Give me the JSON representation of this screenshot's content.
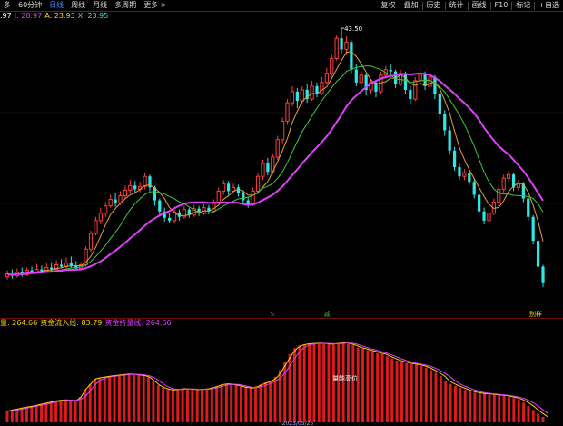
{
  "toolbar": {
    "left": [
      {
        "label": "多",
        "active": false
      },
      {
        "label": "60分钟",
        "active": false
      },
      {
        "label": "日线",
        "active": true
      },
      {
        "label": "周线",
        "active": false
      },
      {
        "label": "月线",
        "active": false
      },
      {
        "label": "多周期",
        "active": false
      },
      {
        "label": "更多 >",
        "active": false
      }
    ],
    "right": [
      "复权",
      "叠加",
      "历史",
      "统计",
      "画线",
      "F10",
      "标记",
      "+自选"
    ]
  },
  "legend": {
    "parts": [
      {
        "text": ".97",
        "color": "#ffffff"
      },
      {
        "text": "J: 28.97",
        "color": "#e040fb"
      },
      {
        "text": "A: 23.93",
        "color": "#ffd400"
      },
      {
        "text": "X: 23.95",
        "color": "#33e0e0"
      }
    ]
  },
  "indicator_legend": {
    "parts": [
      {
        "text": "量: 264.66",
        "color": "#ffd400"
      },
      {
        "text": "资金流入线: 83.79",
        "color": "#ffd400"
      },
      {
        "text": "资金持量线: 264.66",
        "color": "#e040fb"
      }
    ]
  },
  "annotations": {
    "high_price": "43.50",
    "markers": [
      {
        "text": "S",
        "color": "#ff3b3b"
      },
      {
        "text": "减",
        "color": "#33cc33"
      },
      {
        "text": "别样",
        "color": "#ffd400"
      }
    ],
    "indicator_center": "量能高位",
    "bottom_date": "2023/05/25"
  },
  "chart_data": [
    {
      "type": "candlestick",
      "title": "",
      "price_range": [
        14,
        44
      ],
      "label_max": "43.50",
      "candles": [
        [
          16.5,
          16.8,
          17.2,
          16.2
        ],
        [
          16.8,
          16.6,
          17.3,
          16.3
        ],
        [
          16.6,
          17.0,
          17.4,
          16.4
        ],
        [
          17.0,
          16.7,
          17.5,
          16.5
        ],
        [
          16.7,
          17.2,
          17.5,
          16.6
        ],
        [
          17.2,
          17.0,
          17.6,
          16.8
        ],
        [
          17.0,
          17.3,
          17.9,
          16.8
        ],
        [
          17.3,
          17.1,
          17.7,
          16.9
        ],
        [
          17.1,
          17.5,
          18.0,
          17.0
        ],
        [
          17.5,
          17.3,
          18.1,
          17.1
        ],
        [
          17.3,
          17.8,
          18.3,
          17.1
        ],
        [
          17.8,
          17.6,
          18.4,
          17.4
        ],
        [
          17.6,
          18.0,
          18.6,
          17.4
        ],
        [
          18.0,
          17.7,
          18.7,
          17.5
        ],
        [
          17.7,
          17.4,
          18.2,
          17.2
        ],
        [
          17.4,
          17.8,
          18.1,
          17.2
        ],
        [
          17.8,
          19.5,
          19.8,
          17.6
        ],
        [
          19.5,
          21.2,
          21.5,
          19.2
        ],
        [
          21.2,
          22.6,
          23.0,
          21.0
        ],
        [
          22.6,
          23.4,
          24.0,
          22.2
        ],
        [
          23.4,
          24.2,
          24.6,
          23.0
        ],
        [
          24.2,
          24.9,
          25.4,
          24.0
        ],
        [
          24.9,
          24.5,
          25.6,
          24.1
        ],
        [
          24.5,
          25.3,
          25.8,
          24.3
        ],
        [
          25.3,
          25.9,
          26.4,
          25.0
        ],
        [
          25.9,
          26.4,
          27.0,
          25.5
        ],
        [
          26.4,
          26.0,
          26.9,
          25.5
        ],
        [
          26.0,
          26.3,
          26.8,
          25.7
        ],
        [
          26.3,
          27.4,
          27.8,
          26.0
        ],
        [
          27.4,
          26.2,
          27.6,
          25.8
        ],
        [
          26.2,
          24.8,
          26.4,
          24.2
        ],
        [
          24.8,
          23.6,
          25.0,
          23.2
        ],
        [
          23.6,
          22.9,
          24.0,
          22.5
        ],
        [
          22.9,
          22.6,
          23.4,
          22.3
        ],
        [
          22.6,
          23.5,
          24.0,
          22.3
        ],
        [
          23.5,
          23.0,
          23.8,
          22.6
        ],
        [
          23.0,
          23.8,
          24.2,
          22.8
        ],
        [
          23.8,
          23.2,
          24.0,
          22.9
        ],
        [
          23.2,
          23.9,
          24.3,
          23.0
        ],
        [
          23.9,
          23.4,
          24.2,
          23.1
        ],
        [
          23.4,
          24.0,
          24.4,
          23.2
        ],
        [
          24.0,
          23.6,
          24.3,
          23.3
        ],
        [
          23.6,
          24.6,
          24.9,
          23.4
        ],
        [
          24.6,
          25.8,
          26.2,
          24.4
        ],
        [
          25.8,
          26.6,
          27.0,
          25.4
        ],
        [
          26.6,
          25.8,
          26.9,
          25.4
        ],
        [
          25.8,
          26.2,
          26.6,
          25.5
        ],
        [
          26.2,
          25.6,
          26.5,
          25.2
        ],
        [
          25.6,
          24.8,
          25.9,
          24.4
        ],
        [
          24.8,
          24.4,
          25.2,
          24.0
        ],
        [
          24.4,
          25.8,
          26.2,
          24.2
        ],
        [
          25.8,
          27.4,
          27.8,
          25.5
        ],
        [
          27.4,
          28.8,
          29.2,
          27.0
        ],
        [
          28.8,
          27.9,
          29.4,
          27.5
        ],
        [
          27.9,
          29.5,
          29.8,
          27.6
        ],
        [
          29.5,
          31.4,
          31.8,
          29.2
        ],
        [
          31.4,
          33.4,
          33.8,
          31.0
        ],
        [
          33.4,
          35.4,
          35.8,
          33.0
        ],
        [
          35.4,
          36.6,
          37.2,
          35.0
        ],
        [
          36.6,
          35.6,
          37.0,
          34.8
        ],
        [
          35.6,
          36.8,
          37.2,
          35.2
        ],
        [
          36.8,
          35.8,
          37.4,
          35.4
        ],
        [
          35.8,
          37.2,
          37.8,
          35.6
        ],
        [
          37.2,
          36.4,
          37.6,
          36.0
        ],
        [
          36.4,
          37.6,
          38.2,
          36.2
        ],
        [
          37.6,
          38.6,
          39.2,
          37.4
        ],
        [
          38.6,
          40.2,
          40.6,
          38.2
        ],
        [
          40.2,
          42.4,
          42.8,
          40.0
        ],
        [
          42.4,
          41.2,
          43.5,
          40.8
        ],
        [
          41.2,
          42.0,
          42.6,
          40.6
        ],
        [
          42.0,
          39.0,
          42.2,
          38.6
        ],
        [
          39.0,
          37.6,
          39.6,
          37.2
        ],
        [
          37.6,
          38.4,
          38.8,
          37.0
        ],
        [
          38.4,
          36.8,
          38.6,
          36.2
        ],
        [
          36.8,
          37.6,
          38.0,
          36.4
        ],
        [
          37.6,
          36.6,
          37.9,
          36.0
        ],
        [
          36.6,
          38.4,
          38.8,
          36.4
        ],
        [
          38.4,
          39.0,
          39.4,
          38.0
        ],
        [
          39.0,
          38.8,
          39.6,
          38.3
        ],
        [
          38.8,
          37.4,
          39.0,
          37.0
        ],
        [
          37.4,
          38.6,
          39.0,
          37.2
        ],
        [
          38.6,
          36.8,
          38.8,
          36.4
        ],
        [
          36.8,
          35.8,
          37.2,
          35.2
        ],
        [
          35.8,
          37.8,
          38.2,
          35.6
        ],
        [
          37.8,
          38.6,
          39.2,
          37.4
        ],
        [
          38.6,
          37.2,
          38.8,
          36.8
        ],
        [
          37.2,
          38.2,
          38.6,
          36.9
        ],
        [
          38.2,
          36.4,
          38.4,
          35.8
        ],
        [
          36.4,
          34.2,
          36.6,
          33.6
        ],
        [
          34.2,
          32.4,
          34.6,
          31.8
        ],
        [
          32.4,
          30.2,
          32.8,
          29.8
        ],
        [
          30.2,
          28.4,
          30.6,
          28.0
        ],
        [
          28.4,
          27.4,
          28.8,
          27.0
        ],
        [
          27.4,
          27.8,
          28.2,
          27.0
        ],
        [
          27.8,
          26.8,
          28.0,
          26.4
        ],
        [
          26.8,
          25.4,
          27.2,
          25.0
        ],
        [
          25.4,
          23.6,
          25.8,
          23.2
        ],
        [
          23.6,
          22.6,
          24.0,
          22.2
        ],
        [
          22.6,
          23.4,
          23.8,
          22.2
        ],
        [
          23.4,
          24.6,
          25.0,
          23.2
        ],
        [
          24.6,
          26.0,
          26.4,
          24.2
        ],
        [
          26.0,
          27.2,
          27.6,
          25.6
        ],
        [
          27.2,
          27.6,
          28.0,
          26.8
        ],
        [
          27.6,
          26.2,
          27.8,
          25.8
        ],
        [
          26.2,
          26.6,
          27.0,
          25.9
        ],
        [
          26.6,
          25.0,
          26.8,
          24.6
        ],
        [
          25.0,
          23.0,
          25.2,
          22.6
        ],
        [
          23.0,
          20.4,
          23.2,
          20.0
        ],
        [
          20.4,
          17.6,
          20.6,
          17.2
        ],
        [
          17.6,
          15.8,
          17.8,
          15.4
        ]
      ]
    },
    {
      "type": "bar",
      "title": "",
      "value_range": [
        0,
        330
      ],
      "series": [
        {
          "name": "量",
          "values": [
            40,
            45,
            48,
            52,
            55,
            58,
            62,
            66,
            70,
            74,
            78,
            80,
            82,
            80,
            78,
            92,
            120,
            140,
            158,
            162,
            165,
            168,
            170,
            172,
            174,
            176,
            175,
            172,
            170,
            164,
            150,
            135,
            126,
            120,
            118,
            120,
            122,
            121,
            120,
            119,
            120,
            122,
            126,
            132,
            138,
            140,
            138,
            135,
            130,
            126,
            125,
            130,
            138,
            145,
            152,
            165,
            190,
            220,
            248,
            270,
            280,
            284,
            286,
            287,
            288,
            286,
            284,
            286,
            288,
            290,
            285,
            280,
            272,
            268,
            262,
            258,
            252,
            248,
            240,
            232,
            225,
            220,
            215,
            212,
            210,
            205,
            198,
            190,
            180,
            168,
            150,
            140,
            132,
            125,
            118,
            112,
            108,
            105,
            104,
            102,
            100,
            98,
            96,
            92,
            88,
            82,
            72,
            60,
            45,
            32,
            20
          ]
        }
      ]
    }
  ]
}
